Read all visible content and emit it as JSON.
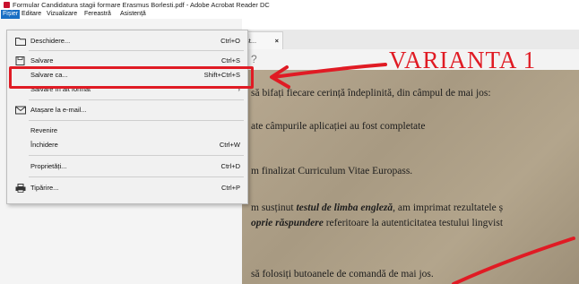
{
  "window": {
    "title": "Formular Candidatura stagii formare Erasmus Borlesti.pdf - Adobe Acrobat Reader DC"
  },
  "menubar": {
    "items": [
      {
        "label": "Fișier",
        "active": true
      },
      {
        "label": "Editare",
        "active": false
      },
      {
        "label": "Vizualizare",
        "active": false
      },
      {
        "label": "Fereastră",
        "active": false
      },
      {
        "label": "Asistență",
        "active": false
      }
    ]
  },
  "tab": {
    "label": "şt...",
    "close": "×"
  },
  "file_menu": {
    "items": [
      {
        "label": "Deschidere...",
        "shortcut": "Ctrl+O",
        "icon": "folder-open-icon"
      },
      {
        "label": "Salvare",
        "shortcut": "Ctrl+S",
        "icon": "save-icon"
      },
      {
        "label": "Salvare ca...",
        "shortcut": "Shift+Ctrl+S",
        "icon": ""
      },
      {
        "label": "Salvare în alt format",
        "shortcut": "›",
        "icon": ""
      },
      {
        "label": "Atașare la e-mail...",
        "shortcut": "",
        "icon": "envelope-icon"
      },
      {
        "label": "Revenire",
        "shortcut": "",
        "icon": ""
      },
      {
        "label": "Închidere",
        "shortcut": "Ctrl+W",
        "icon": ""
      },
      {
        "label": "Proprietăți...",
        "shortcut": "Ctrl+D",
        "icon": ""
      },
      {
        "label": "Tipărire...",
        "shortcut": "Ctrl+P",
        "icon": "printer-icon"
      }
    ]
  },
  "annotation": {
    "text": "VARIANTA 1",
    "color": "#e01b24"
  },
  "document": {
    "lines": [
      {
        "pre": "să bifați fiecare cerință îndeplinită, din câmpul de mai jos:",
        "em": "",
        "post": ""
      },
      {
        "pre": "ate câmpurile aplicației au fost completate",
        "em": "",
        "post": ""
      },
      {
        "pre": "m finalizat Curriculum Vitae Europass.",
        "em": "",
        "post": ""
      },
      {
        "pre": "m susținut ",
        "em": "testul de limba engleză",
        "post": ", am imprimat rezultatele ș"
      },
      {
        "pre": "",
        "em": "oprie răspundere",
        "post": " referitoare la autenticitatea testului lingvist"
      },
      {
        "pre": "să folosiți butoanele de comandă de mai jos.",
        "em": "",
        "post": ""
      }
    ]
  },
  "colors": {
    "menu_highlight": "#1a6fc4",
    "annotation_red": "#e01b24",
    "app_icon": "#c8102e"
  }
}
